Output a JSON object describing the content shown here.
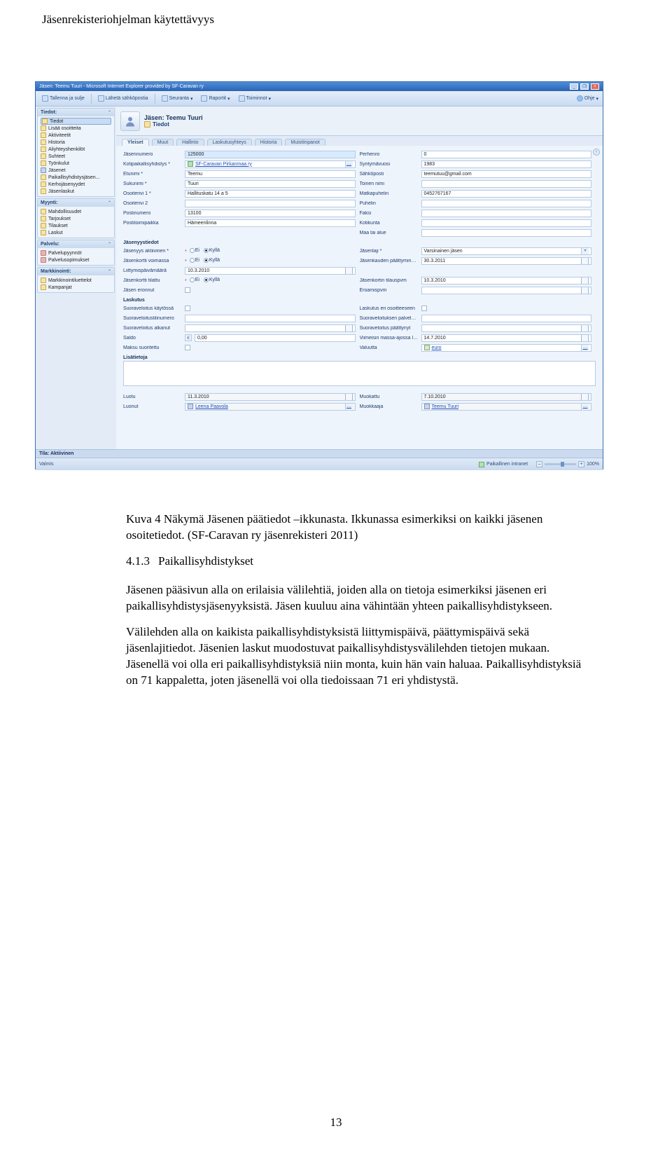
{
  "header": "Jäsenrekisteriohjelman käytettävyys",
  "caption": "Kuva 4  Näkymä Jäsenen päätiedot –ikkunasta. Ikkunassa  esimerkiksi on kaikki jäsenen osoitetiedot. (SF-Caravan ry jäsenrekisteri 2011)",
  "heading_num": "4.1.3",
  "heading_title": "Paikallisyhdistykset",
  "para1": "Jäsenen pääsivun alla on erilaisia välilehtiä, joiden alla on tietoja esimerkiksi jäsenen eri paikallisyhdistysjäsenyyksistä. Jäsen kuuluu aina vähintään yhteen paikallisyhdistykseen.",
  "para2": "Välilehden alla on kaikista paikallisyhdistyksistä liittymispäivä, päättymispäivä sekä jäsenlajitiedot. Jäsenien laskut muodostuvat paikallisyhdistysvälilehden tietojen mukaan. Jäsenellä voi olla eri paikallisyhdistyksiä niin monta, kuin hän vain haluaa. Paikallisyhdistyksiä on 71 kappaletta, joten jäsenellä voi olla tiedoissaan 71 eri yhdistystä.",
  "page_number": "13",
  "screenshot": {
    "titlebar": "Jäsen: Teemu Tuuri - Microsoft Internet Explorer provided by SF-Caravan ry",
    "ribbon": [
      "Tallenna ja sulje",
      "Lähetä sähköpostia",
      "Seuranta",
      "Raportit",
      "Toiminnot"
    ],
    "ribbon_right": "Ohje",
    "sidebar": {
      "tiedot_hd": "Tiedot:",
      "tiedot_items": [
        "Tiedot",
        "Lisää osoitteita",
        "Aktiviteetit",
        "Historia",
        "Aliyhteyshenkilöt",
        "Suhteet",
        "Työnkulut",
        "Jäsenet",
        "Paikallisyhdistysjäsen...",
        "Kerhojäsenyydet",
        "Jäsenlaskut"
      ],
      "hyynti_hd": "Myynti:",
      "hyynti_items": [
        "Mahdollisuudet",
        "Tarjoukset",
        "Tilaukset",
        "Laskut"
      ],
      "palvelu_hd": "Palvelu:",
      "palvelu_items": [
        "Palvelupyynnöt",
        "Palvelusopimukset"
      ],
      "mark_hd": "Markkinointi:",
      "mark_items": [
        "Markkinointiluettelot",
        "Kampanjat"
      ]
    },
    "member_name": "Jäsen: Teemu Tuuri",
    "member_sub": "Tiedot",
    "tabs": [
      "Yleiset",
      "Muut",
      "Hallinto",
      "Laskutusyhteys",
      "Historia",
      "Muistiinpanot"
    ],
    "form": {
      "jasennumero": {
        "label": "Jäsennumero",
        "value": "125000"
      },
      "kotipaikallis": {
        "label": "Kotipaikallisyhdistys *",
        "value": "SF-Caravan Pirkanmaa ry"
      },
      "etunimi": {
        "label": "Etunimi *",
        "value": "Teemu"
      },
      "sukunimi": {
        "label": "Sukunimi *",
        "value": "Tuuri"
      },
      "osoiterivi1": {
        "label": "Osoiterivi 1 *",
        "value": "Hallituskatu 14 a 5"
      },
      "osoiterivi2": {
        "label": "Osoiterivi 2",
        "value": ""
      },
      "postinumero": {
        "label": "Postinumero",
        "value": "13100"
      },
      "postitoimipaikka": {
        "label": "Postitoimipaikka",
        "value": "Hämeenlinna"
      },
      "perhenro": {
        "label": "Perhenro",
        "value": "0"
      },
      "syntymavuosi": {
        "label": "Syntymävuosi",
        "value": "1983"
      },
      "sahkoposti": {
        "label": "Sähköposti",
        "value": "teemutuu@gmail.com"
      },
      "toinen_nimi": {
        "label": "Toinen nimi",
        "value": ""
      },
      "matkapuhelin": {
        "label": "Matkapuhelin",
        "value": "0452767167"
      },
      "puhelin": {
        "label": "Puhelin",
        "value": ""
      },
      "faksi": {
        "label": "Faksi",
        "value": ""
      },
      "kotikunta": {
        "label": "Kotikunta",
        "value": ""
      },
      "maa": {
        "label": "Maa tai alue",
        "value": ""
      },
      "section_jasenyys": "Jäsenyystiedot",
      "jasenyys_akt": {
        "label": "Jäsenyys aktiivinen *",
        "opt_yes": "Kyllä",
        "opt_no": "Ei"
      },
      "jasenkortti_voim": {
        "label": "Jäsenkortti voimassa",
        "opt_yes": "Kyllä",
        "opt_no": "Ei"
      },
      "liittymispvm": {
        "label": "Liittymispäivämäärä",
        "value": "10.3.2010"
      },
      "jasenkortti_til": {
        "label": "Jäsenkortti tilattu",
        "opt_yes": "Kyllä",
        "opt_no": "Ei"
      },
      "jasen_eronnut": {
        "label": "Jäsen eronnut",
        "value": ""
      },
      "jasenlaji": {
        "label": "Jäsenlaji *",
        "value": "Varsinainen jäsen"
      },
      "jasenkauden": {
        "label": "Jäsenkauden päättyminen *",
        "value": "30.3.2011"
      },
      "jasenkortin_til": {
        "label": "Jäsenkortin tilauspvm",
        "value": "10.3.2010"
      },
      "eroamispvm": {
        "label": "Eroamispvm",
        "value": ""
      },
      "section_laskutus": "Laskutus",
      "suoravel_kayt": {
        "label": "Suoraveloitus käytössä",
        "value": ""
      },
      "suoravel_tili": {
        "label": "Suoraveloitustilinumero",
        "value": ""
      },
      "suoravel_alk": {
        "label": "Suoraveloitus alkanut",
        "value": ""
      },
      "saldo": {
        "label": "Saldo",
        "value": "0,00"
      },
      "maksu_suor": {
        "label": "Maksu suoritettu",
        "value": ""
      },
      "lask_eri": {
        "label": "Laskutus eri osoitteeseen",
        "value": ""
      },
      "suoravel_palv": {
        "label": "Suoraveloituksen palvelutunnus",
        "value": ""
      },
      "suoravel_paat": {
        "label": "Suoraveloitus päättynyt",
        "value": ""
      },
      "viimeisin": {
        "label": "Viimeisin massa-ajossa luotu laskuihin",
        "value": "14.7.2010"
      },
      "valuutta": {
        "label": "Valuutta",
        "value": "euro"
      },
      "section_lisa": "Lisätietoja",
      "luotu": {
        "label": "Luotu",
        "value": "11.3.2010"
      },
      "luonut": {
        "label": "Luonut",
        "value": "Leena Paavola"
      },
      "muokattu": {
        "label": "Muokattu",
        "value": "7.10.2010"
      },
      "muokkaaja": {
        "label": "Muokkaaja",
        "value": "Teemu Tuuri"
      }
    },
    "status_top": "Tila: Aktiivinen",
    "status_bot": {
      "left": "Valmis",
      "mid": "Paikallinen intranet",
      "zoom": "100%"
    }
  }
}
